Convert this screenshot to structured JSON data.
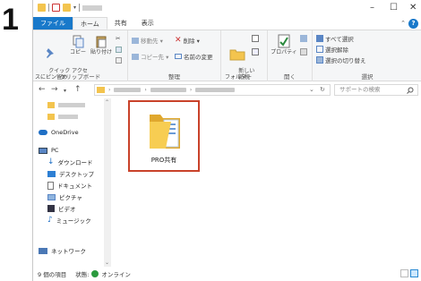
{
  "step_number": "1",
  "titlebar": {
    "minimize": "–",
    "maximize": "☐",
    "close": "✕"
  },
  "ribbon_tabs": [
    "ファイル",
    "ホーム",
    "共有",
    "表示"
  ],
  "ribbon": {
    "clipboard": {
      "pin": "クイック アクセ\nスにピン留め",
      "copy": "コピー",
      "paste": "貼り付け",
      "cut": "✂",
      "label": "クリップボード"
    },
    "organize": {
      "move": "移動先 ▾",
      "copy_to": "コピー先 ▾",
      "delete": "削除 ▾",
      "rename": "名前の変更",
      "label": "整理"
    },
    "new": {
      "new_folder": "新しい\nフォルダー",
      "label": "新規"
    },
    "open": {
      "properties": "プロパティ",
      "label": "開く"
    },
    "select": {
      "select_all": "すべて選択",
      "select_none": "選択解除",
      "invert": "選択の切り替え",
      "label": "選択"
    }
  },
  "addressbar": {
    "back": "←",
    "forward": "→",
    "dropdown": "⌄",
    "up": "↑",
    "refresh": "↻",
    "search_placeholder": "サポートの検索"
  },
  "nav": {
    "onedrive": "OneDrive",
    "pc": "PC",
    "downloads": "ダウンロード",
    "desktop": "デスクトップ",
    "documents": "ドキュメント",
    "pictures": "ピクチャ",
    "videos": "ビデオ",
    "music": "ミュージック",
    "network": "ネットワーク"
  },
  "content": {
    "folder_name": "PRO共有"
  },
  "status": {
    "item_count": "9 個の項目",
    "state_label": "状態:",
    "state_value": "オンライン"
  },
  "colors": {
    "file_tab": "#1979ca",
    "highlight": "#c9422a",
    "folder": "#f7cd52"
  }
}
